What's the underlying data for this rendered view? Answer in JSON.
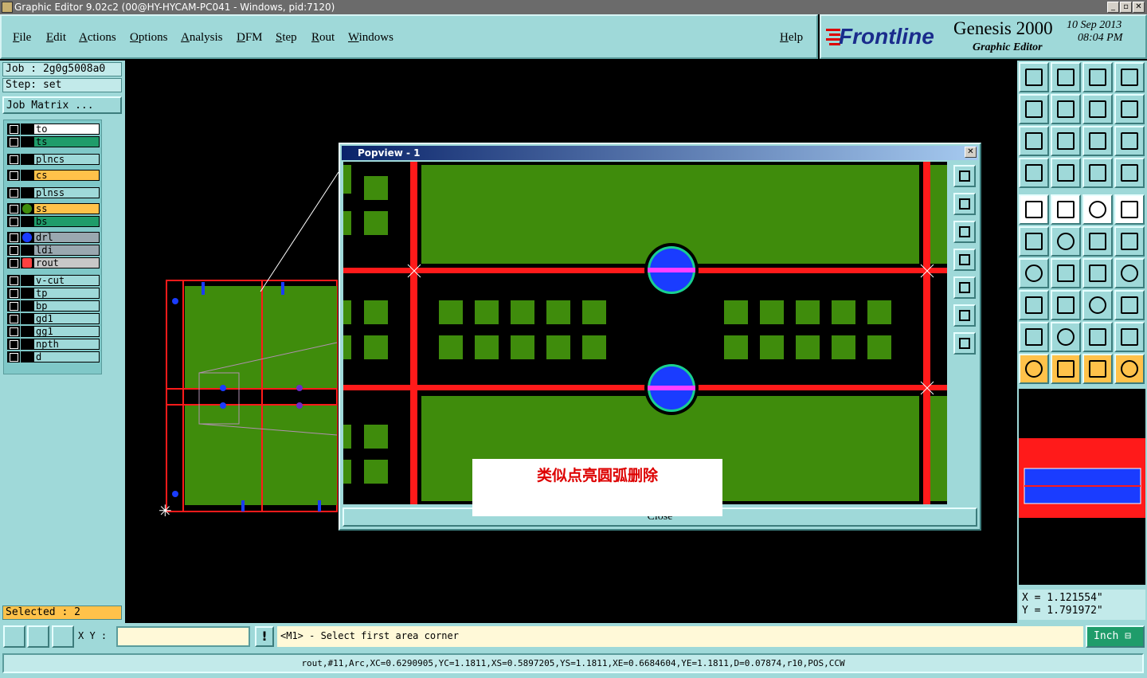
{
  "window": {
    "title": "Graphic Editor 9.02c2 (00@HY-HYCAM-PC041 - Windows, pid:7120)"
  },
  "menu": {
    "items": [
      "File",
      "Edit",
      "Actions",
      "Options",
      "Analysis",
      "DFM",
      "Step",
      "Rout",
      "Windows"
    ],
    "help": "Help"
  },
  "brand": {
    "logo": "Frontline",
    "product": "Genesis 2000",
    "subtitle": "Graphic Editor",
    "date": "10 Sep 2013",
    "time": "08:04 PM"
  },
  "job": {
    "job_label": "Job : 2g0g5008a0",
    "step_label": "Step: set",
    "matrix_button": "Job Matrix ..."
  },
  "layers": [
    {
      "name": "to",
      "bg": "#ffffff",
      "icon": ""
    },
    {
      "name": "ts",
      "bg": "#1f9c6a",
      "icon": ""
    },
    {
      "name": "plncs",
      "bg": "#9fd9d9",
      "icon": ""
    },
    {
      "name": "cs",
      "bg": "#ffc24a",
      "icon": ""
    },
    {
      "name": "plnss",
      "bg": "#9fd9d9",
      "icon": ""
    },
    {
      "name": "ss",
      "bg": "#ffc24a",
      "icon": "green-dot"
    },
    {
      "name": "bs",
      "bg": "#1f9c6a",
      "icon": ""
    },
    {
      "name": "drl",
      "bg": "#9aa8b0",
      "icon": "blue-dot"
    },
    {
      "name": "ldi",
      "bg": "#9aa8b0",
      "icon": ""
    },
    {
      "name": "rout",
      "bg": "#c8c8c8",
      "icon": "edit-arrow"
    },
    {
      "name": "v-cut",
      "bg": "#9fd9d9",
      "icon": ""
    },
    {
      "name": "tp",
      "bg": "#9fd9d9",
      "icon": ""
    },
    {
      "name": "bp",
      "bg": "#9fd9d9",
      "icon": ""
    },
    {
      "name": "gd1",
      "bg": "#9fd9d9",
      "icon": ""
    },
    {
      "name": "gg1",
      "bg": "#9fd9d9",
      "icon": ""
    },
    {
      "name": "npth",
      "bg": "#9fd9d9",
      "icon": ""
    },
    {
      "name": "d",
      "bg": "#9fd9d9",
      "icon": ""
    }
  ],
  "selected": "Selected : 2",
  "popview": {
    "title": "Popview - 1",
    "close_label": "Close"
  },
  "annotation": "类似点亮圆弧删除",
  "coords": {
    "x": "X =  1.121554\"",
    "y": "Y =  1.791972\""
  },
  "status": {
    "xy_label": "X Y :",
    "prompt": "<M1> - Select first area corner",
    "unit": "Inch"
  },
  "feature_info": "rout,#11,Arc,XC=0.6290905,YC=1.1811,XS=0.5897205,YS=1.1811,XE=0.6684604,YE=1.1811,D=0.07874,r10,POS,CCW",
  "colors": {
    "board": "#3f8c0c",
    "rout": "#ff1a1a",
    "drill": "#1a3cff",
    "panel": "#9fd9d9"
  },
  "toolbar_icons": [
    "home-up-icon",
    "home-down-icon",
    "home-icon",
    "window-icon",
    "left-icon",
    "right-icon",
    "undo-icon",
    "redo-icon",
    "fit-icon",
    "zoom-icon",
    "scale-icon",
    "help-icon",
    "snap-icon",
    "grid-icon",
    "layers-icon",
    "layers2-icon",
    "select-icon",
    "measure-icon",
    "ruler-icon",
    "pad-icon",
    "route-icon",
    "cross-icon",
    "line-icon",
    "line2-icon",
    "angle-icon",
    "diag-icon",
    "arc-icon",
    "split-icon",
    "dot-icon",
    "minus-icon",
    "frame-icon",
    "circles-icon",
    "tri1-icon",
    "tri2-icon",
    "tri3-icon",
    "tri4-icon",
    "pointer-icon",
    "pointer2-icon",
    "pointer3-icon",
    "connect-icon"
  ]
}
